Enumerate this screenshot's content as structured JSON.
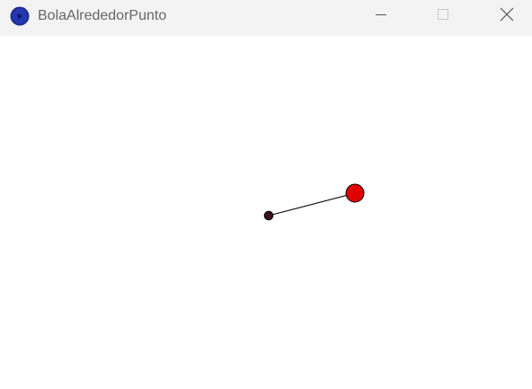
{
  "window": {
    "title": "BolaAlrededorPunto",
    "app_icon": "processing-app-icon",
    "controls": {
      "minimize_icon": "minimize-icon",
      "maximize_icon": "maximize-icon",
      "close_icon": "close-icon"
    }
  },
  "sketch": {
    "background_color": "#ffffff",
    "pivot_color": "#3d0f1f",
    "ball_color": "#e00000",
    "line_color": "#000000"
  }
}
